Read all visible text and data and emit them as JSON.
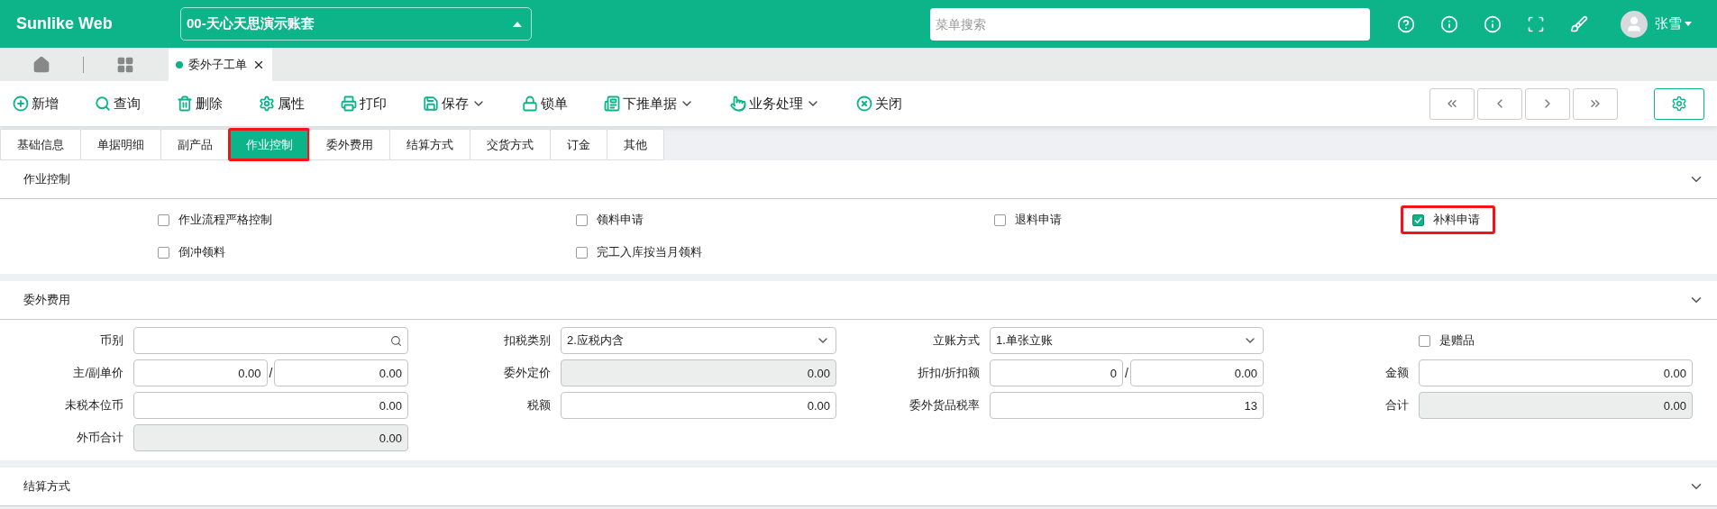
{
  "header": {
    "brand": "Sunlike Web",
    "company": "00-天心天思演示账套",
    "search": {
      "placeholder": "菜单搜索"
    },
    "user": "张雪"
  },
  "doc_tabs": [
    {
      "label": "委外子工单",
      "selected": true
    }
  ],
  "toolbar": [
    {
      "label": "新增",
      "kind": "plus",
      "dropdown": false
    },
    {
      "label": "查询",
      "kind": "search",
      "dropdown": false
    },
    {
      "label": "删除",
      "kind": "trash",
      "dropdown": false
    },
    {
      "label": "属性",
      "kind": "gear",
      "dropdown": false
    },
    {
      "label": "打印",
      "kind": "printer",
      "dropdown": false
    },
    {
      "label": "保存",
      "kind": "save",
      "dropdown": true
    },
    {
      "label": "锁单",
      "kind": "lock",
      "dropdown": false
    },
    {
      "label": "下推单据",
      "kind": "doc",
      "dropdown": true
    },
    {
      "label": "业务处理",
      "kind": "hand",
      "dropdown": true
    },
    {
      "label": "关闭",
      "kind": "close",
      "dropdown": false
    }
  ],
  "form_tabs": [
    {
      "label": "基础信息",
      "selected": false,
      "highlighted": false
    },
    {
      "label": "单据明细",
      "selected": false,
      "highlighted": false
    },
    {
      "label": "副产品",
      "selected": false,
      "highlighted": false
    },
    {
      "label": "作业控制",
      "selected": true,
      "highlighted": true
    },
    {
      "label": "委外费用",
      "selected": false,
      "highlighted": false
    },
    {
      "label": "结算方式",
      "selected": false,
      "highlighted": false
    },
    {
      "label": "交货方式",
      "selected": false,
      "highlighted": false
    },
    {
      "label": "订金",
      "selected": false,
      "highlighted": false
    },
    {
      "label": "其他",
      "selected": false,
      "highlighted": false
    }
  ],
  "control_section": {
    "title": "作业控制",
    "options": [
      {
        "label": "作业流程严格控制",
        "checked": false,
        "highlighted": false
      },
      {
        "label": "领料申请",
        "checked": false,
        "highlighted": false
      },
      {
        "label": "退料申请",
        "checked": false,
        "highlighted": false
      },
      {
        "label": "补料申请",
        "checked": true,
        "highlighted": true
      },
      {
        "label": "倒冲领料",
        "checked": false,
        "highlighted": false
      },
      {
        "label": "完工入库按当月领料",
        "checked": false,
        "highlighted": false
      }
    ]
  },
  "fee_section": {
    "title": "委外费用",
    "fields": [
      {
        "kind": "lookup",
        "label": "币别"
      },
      {
        "kind": "select",
        "label": "扣税类别",
        "value": "2.应税内含"
      },
      {
        "kind": "select",
        "label": "立账方式",
        "value": "1.单张立账"
      },
      {
        "kind": "checkbox",
        "label": "是赠品",
        "checked": false
      },
      {
        "kind": "pair",
        "label": "主/副单价",
        "values": [
          "0.00",
          "0.00"
        ],
        "separator": "/"
      },
      {
        "kind": "readonly",
        "label": "委外定价",
        "value": "0.00"
      },
      {
        "kind": "pair",
        "label": "折扣/折扣额",
        "values": [
          "0",
          "0.00"
        ],
        "separator": "/"
      },
      {
        "kind": "text",
        "label": "金额",
        "value": "0.00"
      },
      {
        "kind": "text",
        "label": "未税本位币",
        "value": "0.00"
      },
      {
        "kind": "text",
        "label": "税额",
        "value": "0.00"
      },
      {
        "kind": "text",
        "label": "委外货品税率",
        "value": "13"
      },
      {
        "kind": "readonly",
        "label": "合计",
        "value": "0.00"
      },
      {
        "kind": "readonly",
        "label": "外币合计",
        "value": "0.00"
      }
    ]
  },
  "settle_section": {
    "title": "结算方式"
  }
}
